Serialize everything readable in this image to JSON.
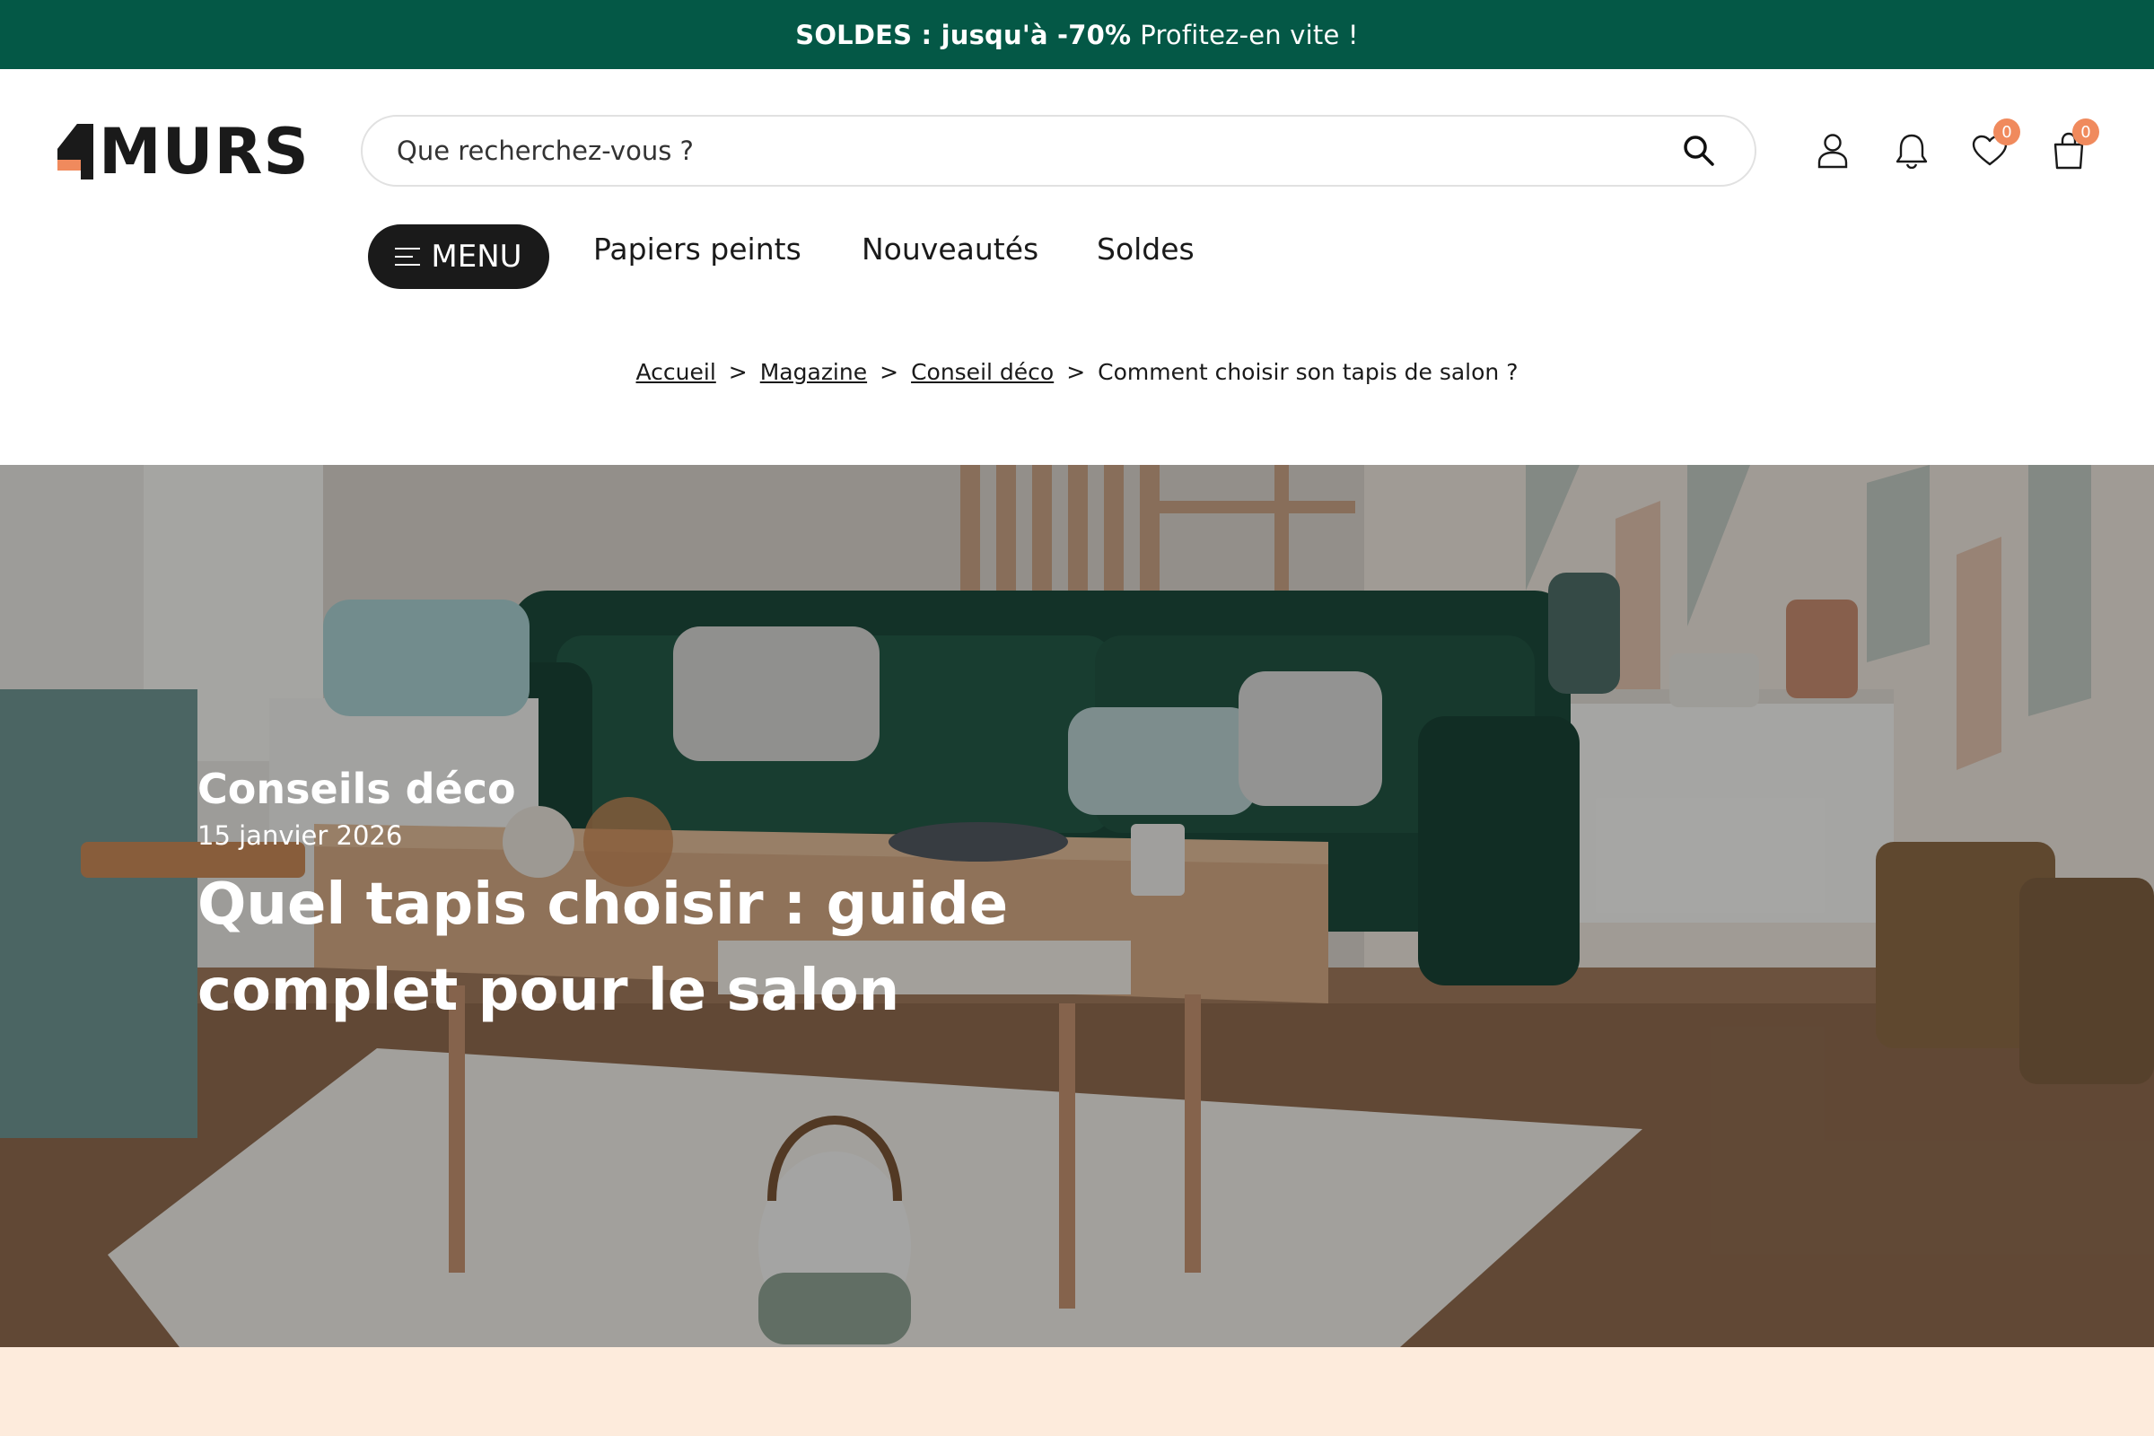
{
  "promo": {
    "strong": "SOLDES : jusqu'à -70%",
    "rest": "Profitez-en vite !"
  },
  "header": {
    "logo_text": "MURS",
    "search_placeholder": "Que recherchez-vous ?",
    "icons": [
      "search-icon",
      "user-icon",
      "bell-icon",
      "heart-icon",
      "bag-icon"
    ],
    "wishlist_count": "0",
    "cart_count": "0"
  },
  "nav": {
    "menu_label": "MENU",
    "links": [
      "Papiers peints",
      "Nouveautés",
      "Soldes"
    ]
  },
  "breadcrumb": {
    "items": [
      "Accueil",
      "Magazine",
      "Conseil déco"
    ],
    "current": "Comment choisir son tapis de salon ?",
    "separator": ">"
  },
  "hero": {
    "category": "Conseils déco",
    "date": "15 janvier 2026",
    "title": "Quel tapis choisir : guide complet pour le salon"
  },
  "colors": {
    "promo_bg": "#045846",
    "accent": "#f08a5d",
    "peach": "#fdebdc",
    "menu_bg": "#1a1a1a"
  }
}
